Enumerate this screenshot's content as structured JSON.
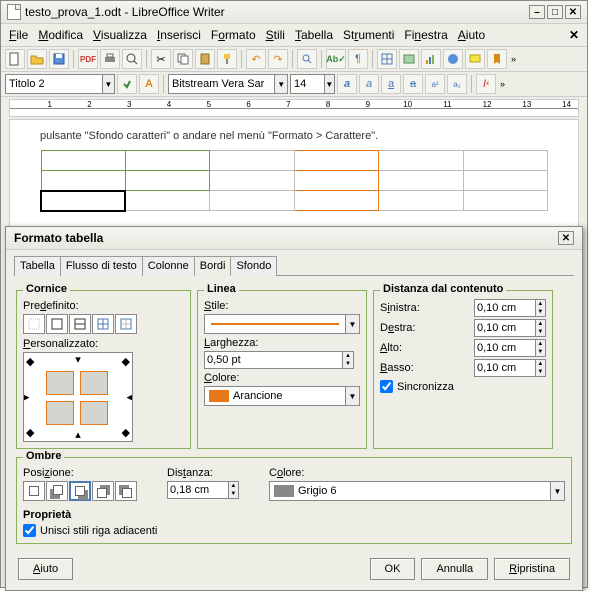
{
  "titlebar": {
    "title": "testo_prova_1.odt - LibreOffice Writer"
  },
  "menu": {
    "file": "File",
    "modifica": "Modifica",
    "visualizza": "Visualizza",
    "inserisci": "Inserisci",
    "formato": "Formato",
    "stili": "Stili",
    "tabella": "Tabella",
    "strumenti": "Strumenti",
    "finestra": "Finestra",
    "aiuto": "Aiuto"
  },
  "format_toolbar": {
    "style": "Titolo 2",
    "font": "Bitstream Vera Sar",
    "size": "14"
  },
  "ruler": {
    "marks": [
      "1",
      "2",
      "3",
      "4",
      "5",
      "6",
      "7",
      "8",
      "9",
      "10",
      "11",
      "12",
      "13",
      "14"
    ]
  },
  "document": {
    "text": "pulsante \"Sfondo caratteri\" o andare nel menù \"Formato > Carattere\"."
  },
  "dialog": {
    "title": "Formato tabella",
    "tabs": [
      "Tabella",
      "Flusso di testo",
      "Colonne",
      "Bordi",
      "Sfondo"
    ],
    "active_tab": "Bordi",
    "cornice": {
      "title": "Cornice",
      "predef": "Predefinito:",
      "custom": "Personalizzato:"
    },
    "linea": {
      "title": "Linea",
      "stile": "Stile:",
      "larghezza": "Larghezza:",
      "larghezza_val": "0,50 pt",
      "colore": "Colore:",
      "colore_val": "Arancione"
    },
    "distanza": {
      "title": "Distanza dal contenuto",
      "sinistra": "Sinistra:",
      "destra": "Destra:",
      "alto": "Alto:",
      "basso": "Basso:",
      "val": "0,10 cm",
      "sync": "Sincronizza"
    },
    "ombre": {
      "title": "Ombre",
      "posizione": "Posizione:",
      "distanza": "Distanza:",
      "distanza_val": "0,18 cm",
      "colore": "Colore:",
      "colore_val": "Grigio 6"
    },
    "proprieta": {
      "title": "Proprietà",
      "unisci": "Unisci stili riga adiacenti"
    },
    "buttons": {
      "aiuto": "Aiuto",
      "ok": "OK",
      "annulla": "Annulla",
      "ripristina": "Ripristina"
    }
  }
}
